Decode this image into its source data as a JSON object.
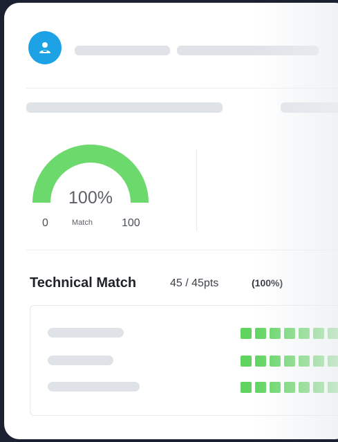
{
  "gauge": {
    "value_text": "100%",
    "value": 100,
    "min_label": "0",
    "max_label": "100",
    "caption": "Match",
    "color": "#6bd96b",
    "track_color": "#e5e8ec"
  },
  "technical": {
    "title": "Technical Match",
    "points": "45 / 45pts",
    "percent": "(100%)",
    "rows": [
      {
        "filled": 7
      },
      {
        "filled": 7
      },
      {
        "filled": 7
      }
    ],
    "block_color": "#5fd45f"
  },
  "colors": {
    "avatar_bg": "#1ea2e6",
    "placeholder": "#dfe3e8"
  },
  "icons": {
    "avatar": "user-icon"
  }
}
